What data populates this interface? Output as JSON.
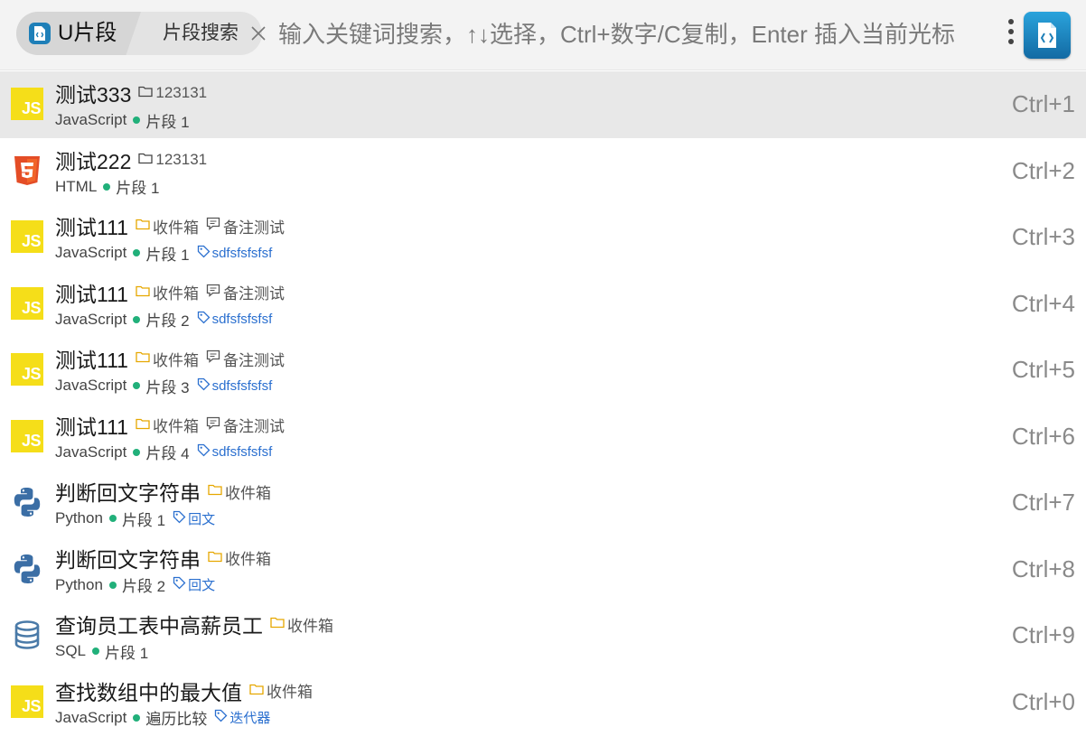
{
  "header": {
    "app_name": "U片段",
    "search_scope": "片段搜索",
    "search_placeholder": "输入关键词搜索，↑↓选择，Ctrl+数字/C复制，Enter 插入当前光标"
  },
  "snippets": [
    {
      "title": "测试333",
      "folder": "123131",
      "note": "",
      "language": "JavaScript",
      "lang_icon": "js-icon",
      "part": "片段 1",
      "tag": "",
      "shortcut": "Ctrl+1",
      "selected": true
    },
    {
      "title": "测试222",
      "folder": "123131",
      "note": "",
      "language": "HTML",
      "lang_icon": "html5-icon",
      "part": "片段 1",
      "tag": "",
      "shortcut": "Ctrl+2",
      "selected": false
    },
    {
      "title": "测试111",
      "folder": "收件箱",
      "note": "备注测试",
      "language": "JavaScript",
      "lang_icon": "js-icon",
      "part": "片段 1",
      "tag": "sdfsfsfsfsf",
      "shortcut": "Ctrl+3",
      "selected": false
    },
    {
      "title": "测试111",
      "folder": "收件箱",
      "note": "备注测试",
      "language": "JavaScript",
      "lang_icon": "js-icon",
      "part": "片段 2",
      "tag": "sdfsfsfsfsf",
      "shortcut": "Ctrl+4",
      "selected": false
    },
    {
      "title": "测试111",
      "folder": "收件箱",
      "note": "备注测试",
      "language": "JavaScript",
      "lang_icon": "js-icon",
      "part": "片段 3",
      "tag": "sdfsfsfsfsf",
      "shortcut": "Ctrl+5",
      "selected": false
    },
    {
      "title": "测试111",
      "folder": "收件箱",
      "note": "备注测试",
      "language": "JavaScript",
      "lang_icon": "js-icon",
      "part": "片段 4",
      "tag": "sdfsfsfsfsf",
      "shortcut": "Ctrl+6",
      "selected": false
    },
    {
      "title": "判断回文字符串",
      "folder": "收件箱",
      "note": "",
      "language": "Python",
      "lang_icon": "python-icon",
      "part": "片段 1",
      "tag": "回文",
      "shortcut": "Ctrl+7",
      "selected": false
    },
    {
      "title": "判断回文字符串",
      "folder": "收件箱",
      "note": "",
      "language": "Python",
      "lang_icon": "python-icon",
      "part": "片段 2",
      "tag": "回文",
      "shortcut": "Ctrl+8",
      "selected": false
    },
    {
      "title": "查询员工表中高薪员工",
      "folder": "收件箱",
      "note": "",
      "language": "SQL",
      "lang_icon": "database-icon",
      "part": "片段 1",
      "tag": "",
      "shortcut": "Ctrl+9",
      "selected": false
    },
    {
      "title": "查找数组中的最大值",
      "folder": "收件箱",
      "note": "",
      "language": "JavaScript",
      "lang_icon": "js-icon",
      "part": "遍历比较",
      "tag": "迭代器",
      "shortcut": "Ctrl+0",
      "selected": false
    }
  ],
  "colors": {
    "accent": "#1e7fb8",
    "status_dot": "#21b07a",
    "tag_blue": "#2a6fcf",
    "folder_yellow": "#e6a700",
    "js_yellow": "#f5de19",
    "html_orange": "#e44d26"
  }
}
